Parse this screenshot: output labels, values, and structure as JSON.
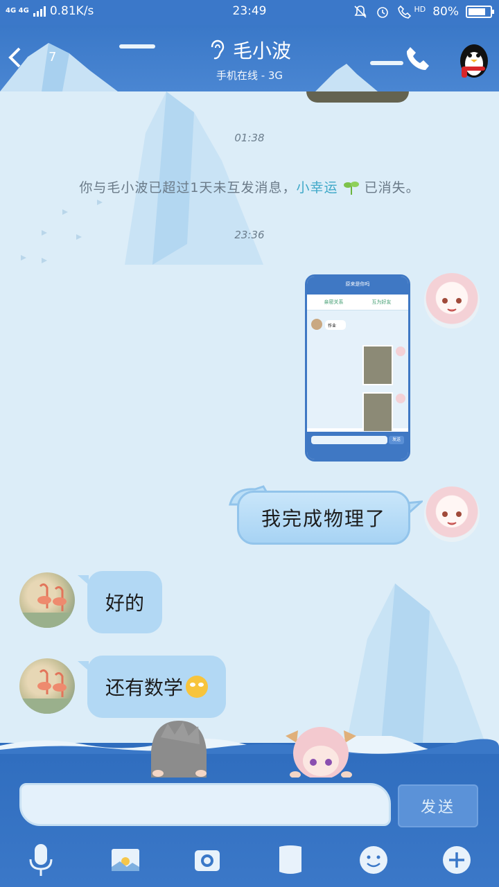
{
  "status_bar": {
    "network": "4G 4G",
    "speed": "0.81K/s",
    "time": "23:49",
    "hd": "HD",
    "battery": "80%",
    "battery_level": 0.8
  },
  "header": {
    "back_count": "7",
    "contact_name": "毛小波",
    "contact_status": "手机在线 - 3G",
    "icons": [
      "chevron-left-icon",
      "ear-icon",
      "phone-icon",
      "penguin-avatar"
    ]
  },
  "chat": {
    "times": [
      "01:38",
      "23:36"
    ],
    "system_message": {
      "prefix": "你与毛小波已超过1天未互发消息，",
      "highlight": "小幸运",
      "suffix": "已消失。"
    },
    "screenshot_preview": {
      "title": "原来是你吗",
      "tab_left": "亲密关系",
      "tab_right": "互为好友",
      "bubble": "作业",
      "send": "发送"
    },
    "messages": [
      {
        "side": "right",
        "text": "我完成物理了"
      },
      {
        "side": "left",
        "text": "好的"
      },
      {
        "side": "left",
        "text": "还有数学",
        "emoji": "confused-face"
      }
    ]
  },
  "input": {
    "value": "",
    "send_label": "发送"
  },
  "toolbar": {
    "icons": [
      "microphone-icon",
      "image-icon",
      "camera-icon",
      "file-icon",
      "smiley-icon",
      "plus-icon"
    ]
  },
  "colors": {
    "header": "#3a78c8",
    "chat_bg": "#dcedf8",
    "bubble_blue": "#b2d8f4",
    "highlight": "#3ea8c8"
  }
}
